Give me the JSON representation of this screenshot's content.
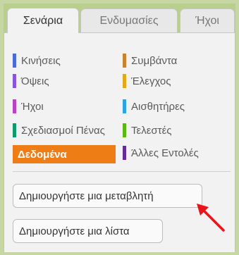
{
  "tabs": [
    {
      "label": "Σενάρια",
      "active": true
    },
    {
      "label": "Ενδυμασίες",
      "active": false
    },
    {
      "label": "Ήχοι",
      "active": false
    }
  ],
  "categories_left": [
    {
      "label": "Κινήσεις",
      "color": "#4a6cd4"
    },
    {
      "label": "Όψεις",
      "color": "#8a55d7"
    },
    {
      "label": "Ήχοι",
      "color": "#bb42c3"
    },
    {
      "label": "Σχεδιασμοί Πένας",
      "color": "#0e9a6c"
    },
    {
      "label": "Δεδομένα",
      "color": "#ee7d16",
      "selected": true
    }
  ],
  "categories_right": [
    {
      "label": "Συμβάντα",
      "color": "#c88330"
    },
    {
      "label": "Έλεγχος",
      "color": "#e1a91a"
    },
    {
      "label": "Αισθητήρες",
      "color": "#2ca5e2"
    },
    {
      "label": "Τελεστές",
      "color": "#5cb712"
    },
    {
      "label": "Άλλες Εντολές",
      "color": "#632d99"
    }
  ],
  "buttons": {
    "make_variable": "Δημιουργήστε μια μεταβλητή",
    "make_list": "Δημιουργήστε μια λίστα"
  },
  "colors": {
    "annotation_arrow": "#e8141c",
    "frame": "#c6d7a3"
  }
}
